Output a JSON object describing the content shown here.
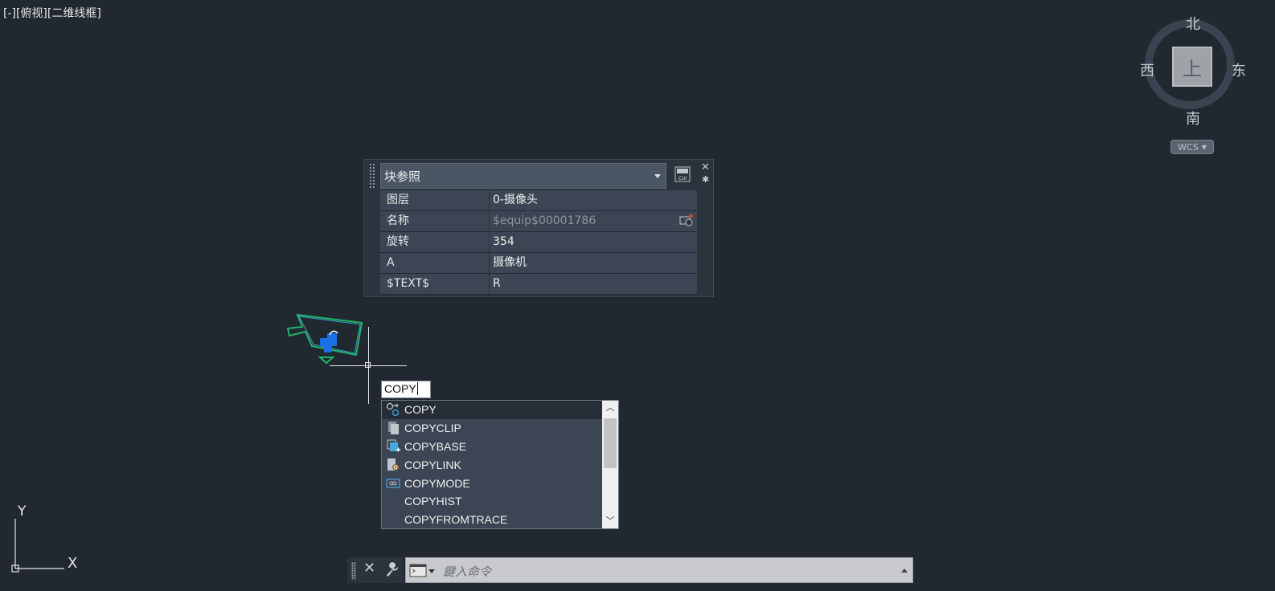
{
  "viewport": {
    "label": "[-][俯视][二维线框]"
  },
  "viewcube": {
    "north": "北",
    "south": "南",
    "west": "西",
    "east": "东",
    "face": "上",
    "wcs": "WCS"
  },
  "quick_properties": {
    "object_type": "块参照",
    "rows": [
      {
        "key": "图层",
        "value": "0-摄像头"
      },
      {
        "key": "名称",
        "value": "$equip$00001786"
      },
      {
        "key": "旋转",
        "value": "354"
      },
      {
        "key": "A",
        "value": "摄像机"
      },
      {
        "key": "$TEXT$",
        "value": "R"
      }
    ]
  },
  "dynamic_input": {
    "value": "COPY"
  },
  "autocomplete": {
    "items": [
      {
        "label": "COPY",
        "icon": "copy-icon",
        "selected": true
      },
      {
        "label": "COPYCLIP",
        "icon": "copyclip-icon"
      },
      {
        "label": "COPYBASE",
        "icon": "copybase-icon"
      },
      {
        "label": "COPYLINK",
        "icon": "copylink-icon"
      },
      {
        "label": "COPYMODE",
        "icon": "copymode-icon"
      },
      {
        "label": "COPYHIST",
        "icon": ""
      },
      {
        "label": "COPYFROMTRACE",
        "icon": ""
      }
    ]
  },
  "ucs": {
    "x_label": "X",
    "y_label": "Y"
  },
  "command_line": {
    "placeholder": "鍵入命令"
  },
  "colors": {
    "background": "#212830",
    "selection_green": "#1fb36b",
    "grip_blue": "#1a6ee6"
  }
}
